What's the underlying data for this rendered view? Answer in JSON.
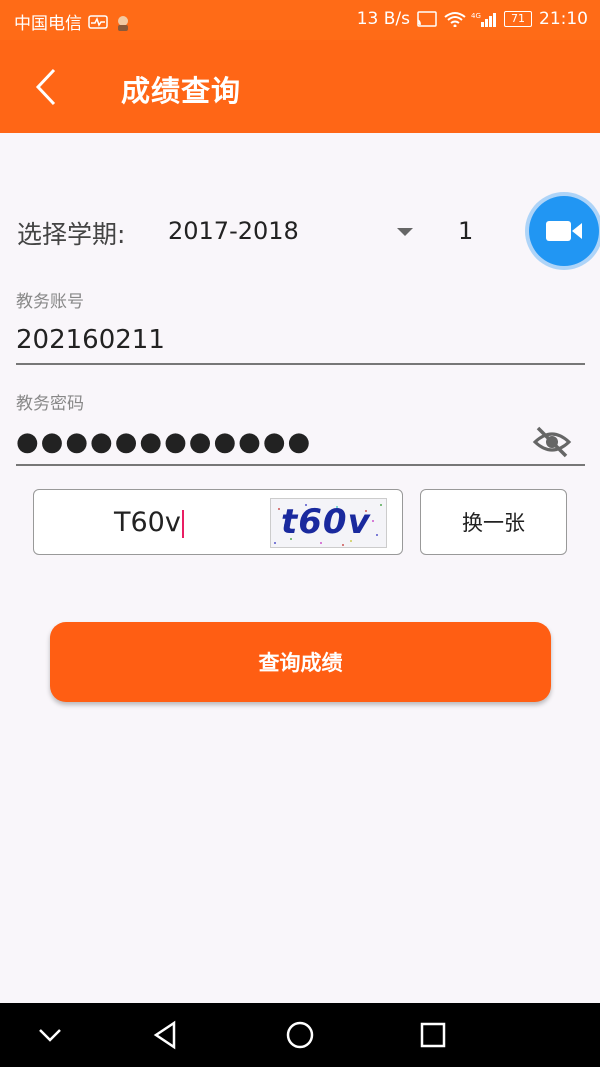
{
  "status_bar": {
    "carrier": "中国电信",
    "speed": "13 B/s",
    "network": "4G",
    "battery": "71",
    "time": "21:10"
  },
  "app_bar": {
    "title": "成绩查询"
  },
  "semester": {
    "label": "选择学期:",
    "year": "2017-2018",
    "term": "1"
  },
  "account": {
    "label": "教务账号",
    "value": "202160211"
  },
  "password": {
    "label": "教务密码",
    "masked": "●●●●●●●●●●●●"
  },
  "captcha": {
    "input_value": "T60v",
    "image_text": "t60v",
    "refresh_label": "换一张"
  },
  "query_button": {
    "label": "查询成绩"
  },
  "colors": {
    "primary": "#ff6616",
    "accent_blue": "#2196f3"
  }
}
